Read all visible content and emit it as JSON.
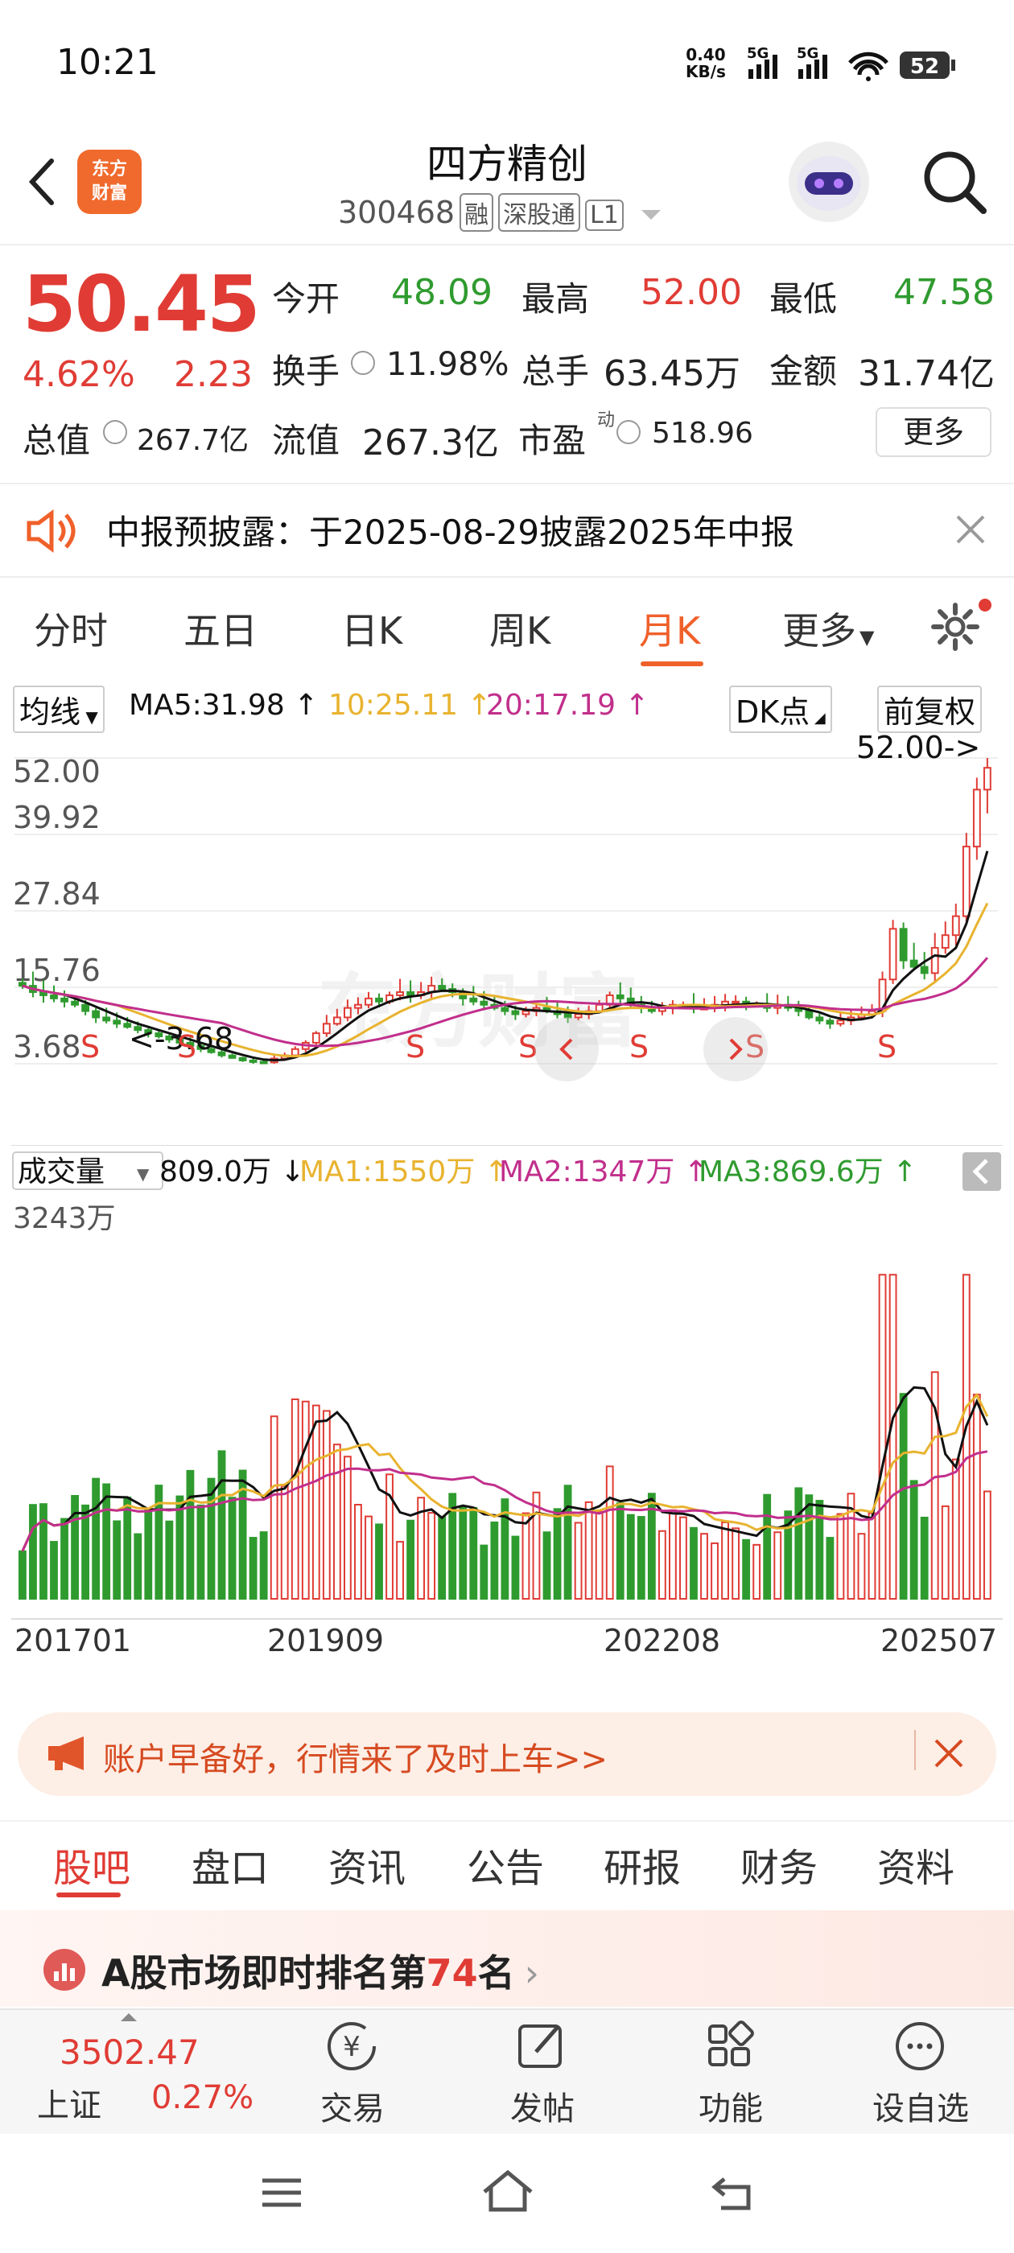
{
  "status": {
    "time": "10:21",
    "net_speed": "0.40",
    "net_unit": "KB/s",
    "sig1": "5G",
    "sig2": "5G",
    "battery": "52"
  },
  "header": {
    "logo_line1": "东方",
    "logo_line2": "财富",
    "title": "四方精创",
    "code": "300468",
    "tags": [
      "融",
      "深股通",
      "L1"
    ]
  },
  "quote": {
    "price": "50.45",
    "change_pct": "4.62%",
    "change": "2.23",
    "open_label": "今开",
    "open": "48.09",
    "high_label": "最高",
    "high": "52.00",
    "low_label": "最低",
    "low": "47.58",
    "turnover_label": "换手",
    "turnover": "11.98%",
    "volume_label": "总手",
    "volume": "63.45万",
    "amount_label": "金额",
    "amount": "31.74亿",
    "mktcap_label": "总值",
    "mktcap": "267.7亿",
    "float_label": "流值",
    "float": "267.3亿",
    "pe_label": "市盈",
    "pe_sup": "动",
    "pe": "518.96",
    "more": "更多"
  },
  "notice": {
    "text": "中报预披露：于2025-08-29披露2025年中报"
  },
  "ktabs": [
    "分时",
    "五日",
    "日K",
    "周K",
    "月K",
    "更多"
  ],
  "ma": {
    "selector": "均线",
    "ma5": "MA5:31.98 ↑",
    "ma10": "10:25.11 ↑",
    "ma20": "20:17.19 ↑",
    "dk": "DK点",
    "fq": "前复权"
  },
  "chart_data": {
    "type": "candlestick",
    "price_axis": [
      "52.00",
      "39.92",
      "27.84",
      "15.76",
      "3.68"
    ],
    "ylim": [
      3.68,
      52.0
    ],
    "max_label": "52.00->",
    "min_label": "<-3.68",
    "watermark": "东方财富",
    "signal_labels": [
      "S",
      "S",
      "S",
      "S",
      "S",
      "S",
      "S"
    ],
    "x_labels": [
      "201701",
      "201909",
      "202208",
      "202507"
    ],
    "close": [
      16,
      15,
      14.5,
      14,
      13.5,
      13,
      12,
      11,
      10.5,
      10,
      9.5,
      9,
      8.5,
      8,
      7.5,
      7,
      6.5,
      6,
      5.5,
      5,
      4.6,
      4.2,
      4.0,
      3.9,
      4.5,
      5,
      6,
      7,
      8.5,
      10,
      11,
      12.5,
      13,
      14,
      13.5,
      14.5,
      15,
      14.5,
      15,
      16,
      15.5,
      15,
      14,
      13.5,
      13,
      12.5,
      12,
      11.5,
      12,
      12.5,
      12,
      11.5,
      11,
      11.5,
      12,
      13,
      14.5,
      14,
      13,
      12.5,
      12,
      12.5,
      13,
      13,
      12.5,
      12.5,
      13,
      13.5,
      13.5,
      13,
      13,
      12.5,
      13,
      12.5,
      12,
      11,
      10.5,
      10,
      10.5,
      11,
      11.5,
      12,
      17,
      25,
      20,
      19,
      18,
      22,
      24,
      27,
      38,
      47,
      50.45
    ],
    "volume_axis_max": "3243万",
    "volume": {
      "selector": "成交量",
      "value": "809.0万 ↓",
      "ma1": "MA1:1550万 ↑",
      "ma2": "MA2:1347万 ↑",
      "ma3": "MA3:869.6万 ↑"
    },
    "colors": {
      "up": "#e03c35",
      "down": "#2f9b2f",
      "ma5": "#111111",
      "ma10": "#e8b32f",
      "ma20": "#c12f8c"
    }
  },
  "banner": {
    "text": "账户早备好，行情来了及时上车>>"
  },
  "bottom_tabs": [
    "股吧",
    "盘口",
    "资讯",
    "公告",
    "研报",
    "财务",
    "资料"
  ],
  "rank": {
    "prefix": "A股市场即时排名第",
    "num": "74",
    "suffix": "名"
  },
  "bottombar": {
    "index_value": "3502.47",
    "index_name": "上证",
    "index_pct": "0.27%",
    "buttons": [
      "交易",
      "发帖",
      "功能",
      "设自选"
    ]
  }
}
